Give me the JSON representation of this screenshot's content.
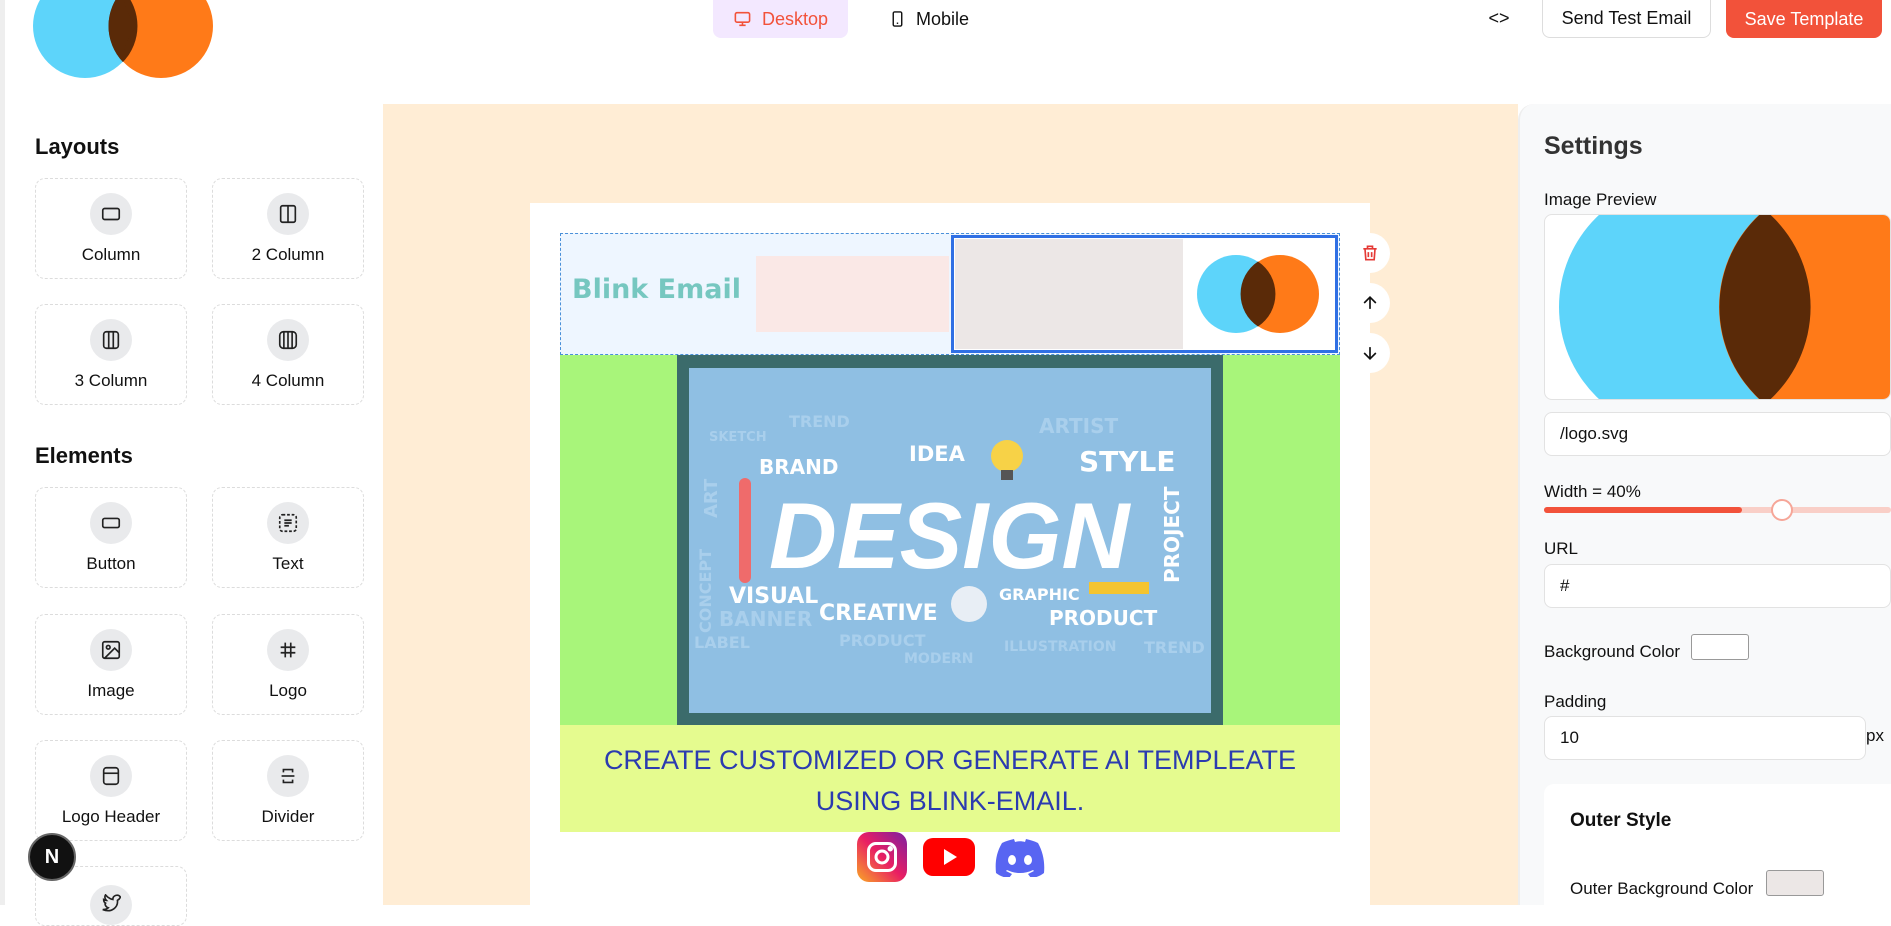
{
  "topbar": {
    "desktop_label": "Desktop",
    "mobile_label": "Mobile",
    "code_glyph": "<>",
    "send_test_label": "Send Test Email",
    "save_label": "Save Template"
  },
  "sidebar": {
    "layouts_title": "Layouts",
    "layouts": [
      {
        "label": "Column",
        "icon": "column-icon"
      },
      {
        "label": "2 Column",
        "icon": "two-column-icon"
      },
      {
        "label": "3 Column",
        "icon": "three-column-icon"
      },
      {
        "label": "4 Column",
        "icon": "four-column-icon"
      }
    ],
    "elements_title": "Elements",
    "elements": [
      {
        "label": "Button",
        "icon": "button-icon"
      },
      {
        "label": "Text",
        "icon": "text-icon"
      },
      {
        "label": "Image",
        "icon": "image-icon"
      },
      {
        "label": "Logo",
        "icon": "logo-hash-icon"
      },
      {
        "label": "Logo Header",
        "icon": "logo-header-icon"
      },
      {
        "label": "Divider",
        "icon": "divider-icon"
      }
    ],
    "badge": "N"
  },
  "email": {
    "brand": "Blink Email",
    "hero_words": {
      "main": "DESIGN",
      "brand": "BRAND",
      "idea": "IDEA",
      "style": "STYLE",
      "visual": "VISUAL",
      "creative": "CREATIVE",
      "graphic": "GRAPHIC",
      "product": "PRODUCT",
      "project": "PROJECT",
      "banner": "BANNER",
      "trend": "TREND",
      "artist": "ARTIST",
      "sketch": "SKETCH",
      "label": "LABEL",
      "art": "ART",
      "concept": "CONCEPT",
      "modern": "MODERN",
      "illustration": "ILLUSTRATION"
    },
    "cta_line1": "CREATE CUSTOMIZED OR GENERATE AI TEMPLEATE",
    "cta_line2": "USING BLINK-EMAIL.",
    "social": [
      "instagram-icon",
      "youtube-icon",
      "discord-icon"
    ]
  },
  "settings": {
    "title": "Settings",
    "image_preview_label": "Image Preview",
    "image_src": "/logo.svg",
    "width_label": "Width = 40%",
    "width_value": 0.4,
    "url_label": "URL",
    "url_value": "#",
    "bg_color_label": "Background Color",
    "bg_color": "#ffffff",
    "padding_label": "Padding",
    "padding_value": "10",
    "padding_unit": "px",
    "outer_style_title": "Outer Style",
    "outer_bg_label": "Outer Background Color",
    "outer_bg_color": "#ece7e6"
  },
  "colors": {
    "accent": "#f2523a",
    "logo_blue": "#5dd4fa",
    "logo_orange": "#ff7a18",
    "logo_overlap": "#5a2a08",
    "canvas_bg": "#ffedd5",
    "cta_text": "#2b3bb0"
  }
}
